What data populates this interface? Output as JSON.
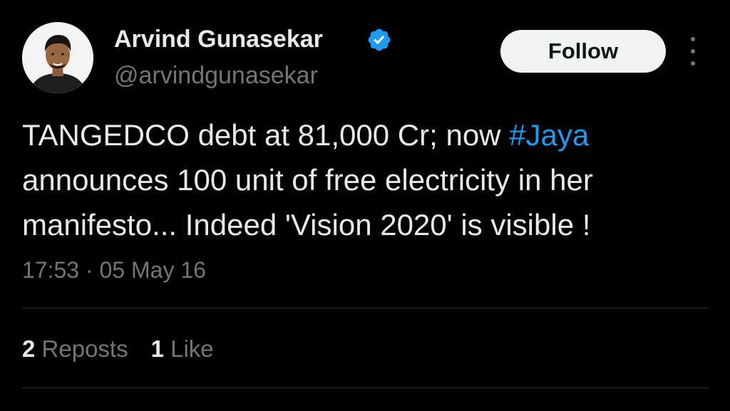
{
  "author": {
    "name": "Arvind Gunasekar",
    "handle": "@arvindgunasekar",
    "verified": true
  },
  "actions": {
    "follow_label": "Follow"
  },
  "tweet": {
    "text_line1_prefix": "TANGEDCO debt at 81,000 Cr; now ",
    "hashtag": "#Jaya",
    "text_line2": "announces 100 unit of free electricity in her",
    "text_line3": "manifesto... Indeed 'Vision 2020' is visible !",
    "timestamp": "17:53 · 05 May 16"
  },
  "stats": {
    "reposts_count": "2",
    "reposts_label": "Reposts",
    "likes_count": "1",
    "likes_label": "Like"
  },
  "colors": {
    "background": "#000000",
    "text": "#e7e9ea",
    "secondary": "#71767b",
    "accent": "#1d9bf0",
    "divider": "#2f3336"
  },
  "icons": [
    "verified-badge-icon",
    "more-options-icon",
    "avatar"
  ]
}
